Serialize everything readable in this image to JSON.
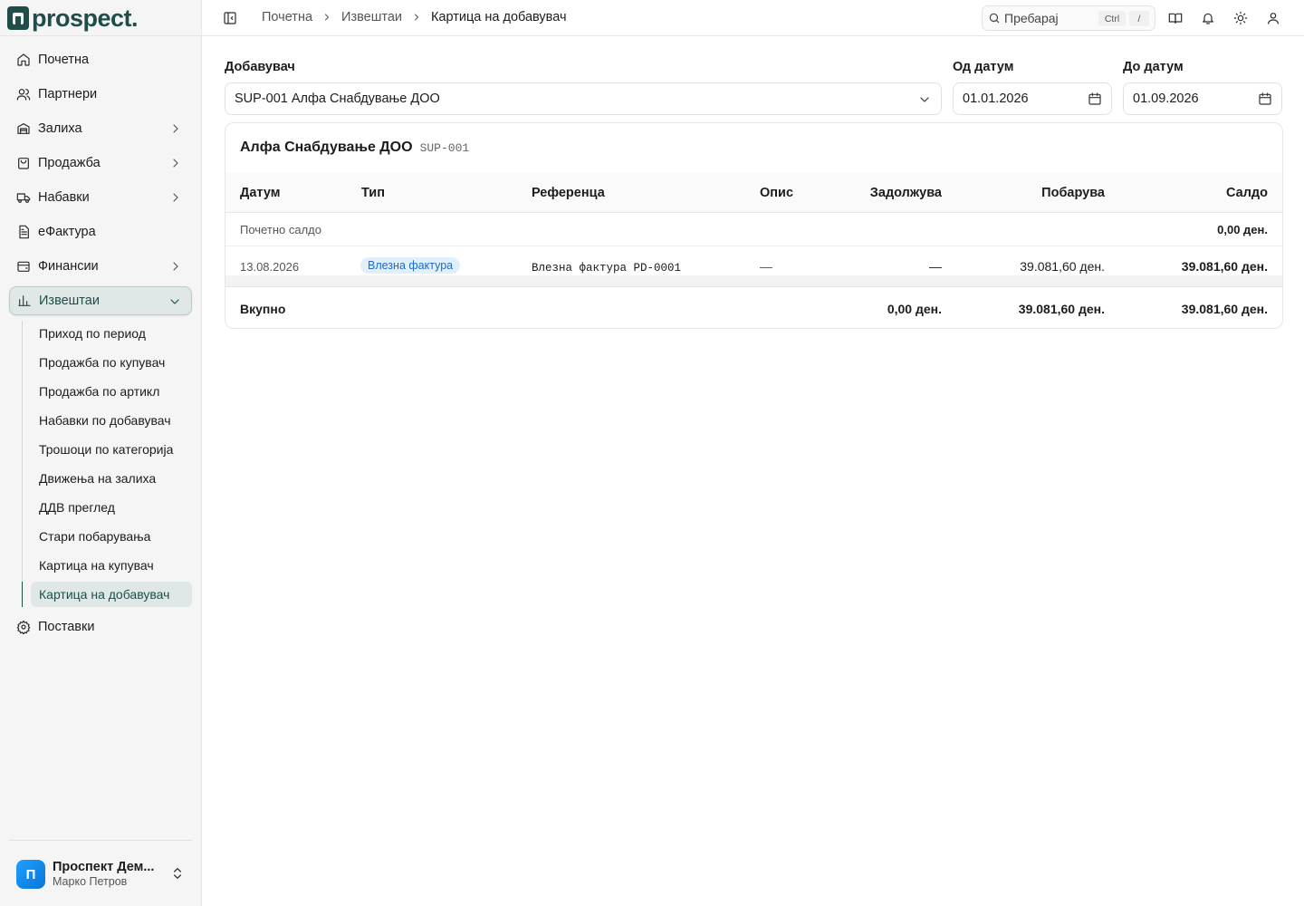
{
  "app": {
    "logo_text": "prospect."
  },
  "sidebar": {
    "items": [
      {
        "label": "Почетна",
        "icon": "home-icon"
      },
      {
        "label": "Партнери",
        "icon": "users-icon"
      },
      {
        "label": "Залиха",
        "icon": "warehouse-icon"
      },
      {
        "label": "Продажба",
        "icon": "shopping-bag-icon"
      },
      {
        "label": "Набавки",
        "icon": "truck-icon"
      },
      {
        "label": "еФактура",
        "icon": "file-text-icon"
      },
      {
        "label": "Финансии",
        "icon": "wallet-icon"
      },
      {
        "label": "Извештаи",
        "icon": "bar-chart-icon"
      },
      {
        "label": "Поставки",
        "icon": "gear-icon"
      }
    ],
    "reports_sub": [
      "Приход по период",
      "Продажба по купувач",
      "Продажба по артикл",
      "Набавки по добавувач",
      "Трошоци по категорија",
      "Движења на залиха",
      "ДДВ преглед",
      "Стари побарувања",
      "Картица на купувач",
      "Картица на добавувач"
    ],
    "user": {
      "initial": "П",
      "name": "Проспект Дем...",
      "role": "Марко Петров"
    }
  },
  "topbar": {
    "breadcrumb": [
      "Почетна",
      "Извештаи",
      "Картица на добавувач"
    ],
    "search": {
      "placeholder": "Пребарај",
      "kbd1": "Ctrl",
      "kbd2": "/"
    }
  },
  "filters": {
    "supplier_label": "Добавувач",
    "supplier_value": "SUP-001 Алфа Снабдување ДОО",
    "from_label": "Од датум",
    "from_value": "01.01.2026",
    "to_label": "До датум",
    "to_value": "01.09.2026"
  },
  "card": {
    "title": "Алфа Снабдување ДОО",
    "code": "SUP-001",
    "columns": [
      "Датум",
      "Тип",
      "Референца",
      "Опис",
      "Задолжува",
      "Побарува",
      "Салдо"
    ],
    "opening": {
      "label": "Почетно салдо",
      "balance": "0,00 ден."
    },
    "rows": [
      {
        "date": "13.08.2026",
        "type": "Влезна фактура",
        "reference": "Влезна фактура PD-0001",
        "description": "—",
        "debit": "—",
        "credit": "39.081,60 ден.",
        "balance": "39.081,60 ден."
      }
    ],
    "total": {
      "label": "Вкупно",
      "debit": "0,00 ден.",
      "credit": "39.081,60 ден.",
      "balance": "39.081,60 ден."
    }
  },
  "colors": {
    "brand": "#1f4e4a",
    "active_bg": "#dfe8e7",
    "badge_bg": "#e1effd",
    "badge_text": "#1d6bc4"
  }
}
